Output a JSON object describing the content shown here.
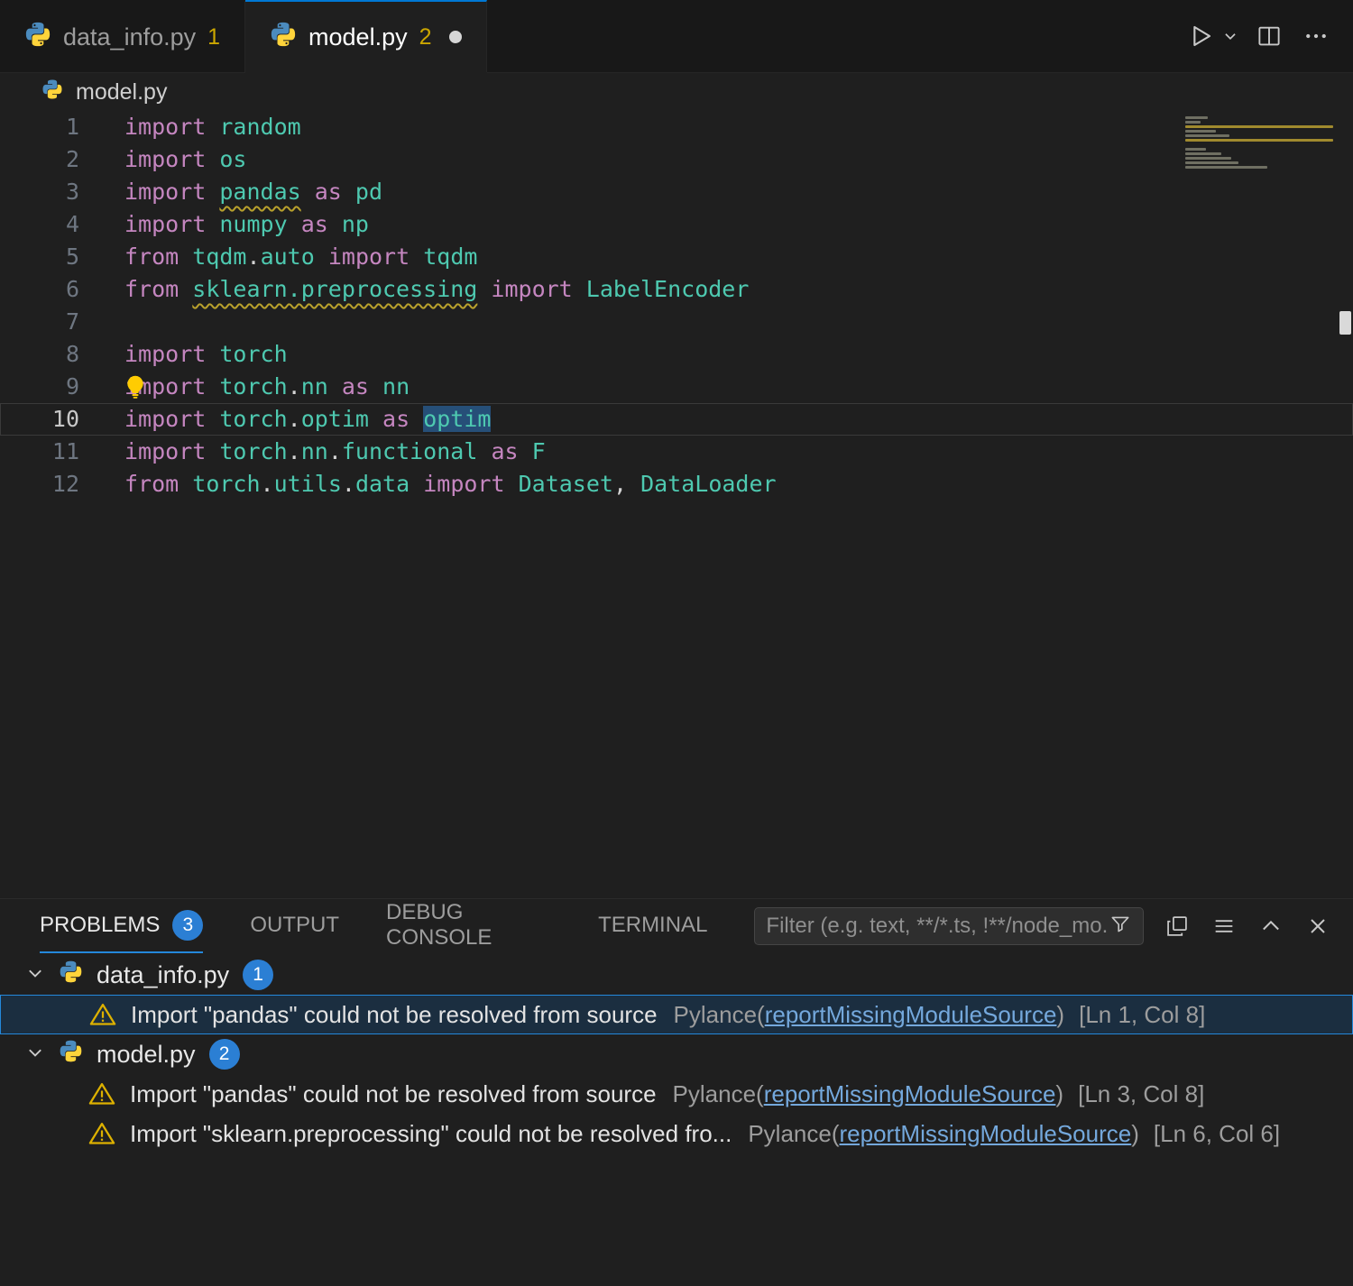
{
  "colors": {
    "accent": "#0078d4",
    "warning": "#cca700",
    "badge_blue": "#2b7fd4",
    "link": "#74a8dc",
    "selection": "#264f78",
    "keyword": "#c586c0",
    "module": "#4ec9b0"
  },
  "icons": {
    "python-icon": "python-logo",
    "run-icon": "play-triangle-outline",
    "run-chevron-icon": "chevron-down",
    "split-editor-icon": "rect-split-vertical",
    "more-actions-icon": "ellipsis",
    "filter-icon": "funnel",
    "collapse-all-icon": "overlapping-squares",
    "view-as-table-icon": "horizontal-lines",
    "maximize-panel-icon": "chevron-up",
    "close-panel-icon": "x",
    "warning-icon": "triangle-exclamation",
    "lightbulb-icon": "lightbulb",
    "chevron-down-icon": "chevron-down",
    "modified-dot": "filled-circle"
  },
  "editor_tabs": [
    {
      "label": "data_info.py",
      "badge": "1",
      "modified": false,
      "active": false
    },
    {
      "label": "model.py",
      "badge": "2",
      "modified": true,
      "active": true
    }
  ],
  "breadcrumb": {
    "file": "model.py"
  },
  "editor": {
    "lines": [
      {
        "num": "1",
        "tokens": [
          [
            "k",
            "import"
          ],
          [
            "p",
            " "
          ],
          [
            "m",
            "random"
          ]
        ]
      },
      {
        "num": "2",
        "tokens": [
          [
            "k",
            "import"
          ],
          [
            "p",
            " "
          ],
          [
            "m",
            "os"
          ]
        ]
      },
      {
        "num": "3",
        "warning": true,
        "tokens": [
          [
            "k",
            "import"
          ],
          [
            "p",
            " "
          ],
          [
            "mw",
            "pandas"
          ],
          [
            "p",
            " "
          ],
          [
            "k",
            "as"
          ],
          [
            "p",
            " "
          ],
          [
            "m",
            "pd"
          ]
        ]
      },
      {
        "num": "4",
        "tokens": [
          [
            "k",
            "import"
          ],
          [
            "p",
            " "
          ],
          [
            "m",
            "numpy"
          ],
          [
            "p",
            " "
          ],
          [
            "k",
            "as"
          ],
          [
            "p",
            " "
          ],
          [
            "m",
            "np"
          ]
        ]
      },
      {
        "num": "5",
        "tokens": [
          [
            "k",
            "from"
          ],
          [
            "p",
            " "
          ],
          [
            "m",
            "tqdm"
          ],
          [
            "p",
            "."
          ],
          [
            "m",
            "auto"
          ],
          [
            "p",
            " "
          ],
          [
            "k",
            "import"
          ],
          [
            "p",
            " "
          ],
          [
            "m",
            "tqdm"
          ]
        ]
      },
      {
        "num": "6",
        "warning": true,
        "tokens": [
          [
            "k",
            "from"
          ],
          [
            "p",
            " "
          ],
          [
            "mw",
            "sklearn.preprocessing"
          ],
          [
            "p",
            " "
          ],
          [
            "k",
            "import"
          ],
          [
            "p",
            " "
          ],
          [
            "m",
            "LabelEncoder"
          ]
        ]
      },
      {
        "num": "7",
        "tokens": []
      },
      {
        "num": "8",
        "tokens": [
          [
            "k",
            "import"
          ],
          [
            "p",
            " "
          ],
          [
            "m",
            "torch"
          ]
        ]
      },
      {
        "num": "9",
        "lightbulb": true,
        "tokens": [
          [
            "k",
            "import"
          ],
          [
            "p",
            " "
          ],
          [
            "m",
            "torch"
          ],
          [
            "p",
            "."
          ],
          [
            "m",
            "nn"
          ],
          [
            "p",
            " "
          ],
          [
            "k",
            "as"
          ],
          [
            "p",
            " "
          ],
          [
            "m",
            "nn"
          ]
        ]
      },
      {
        "num": "10",
        "current": true,
        "tokens": [
          [
            "k",
            "import"
          ],
          [
            "p",
            " "
          ],
          [
            "m",
            "torch"
          ],
          [
            "p",
            "."
          ],
          [
            "m",
            "optim"
          ],
          [
            "p",
            " "
          ],
          [
            "k",
            "as"
          ],
          [
            "p",
            " "
          ],
          [
            "msel",
            "optim"
          ]
        ]
      },
      {
        "num": "11",
        "tokens": [
          [
            "k",
            "import"
          ],
          [
            "p",
            " "
          ],
          [
            "m",
            "torch"
          ],
          [
            "p",
            "."
          ],
          [
            "m",
            "nn"
          ],
          [
            "p",
            "."
          ],
          [
            "m",
            "functional"
          ],
          [
            "p",
            " "
          ],
          [
            "k",
            "as"
          ],
          [
            "p",
            " "
          ],
          [
            "m",
            "F"
          ]
        ]
      },
      {
        "num": "12",
        "tokens": [
          [
            "k",
            "from"
          ],
          [
            "p",
            " "
          ],
          [
            "m",
            "torch"
          ],
          [
            "p",
            "."
          ],
          [
            "m",
            "utils"
          ],
          [
            "p",
            "."
          ],
          [
            "m",
            "data"
          ],
          [
            "p",
            " "
          ],
          [
            "k",
            "import"
          ],
          [
            "p",
            " "
          ],
          [
            "m",
            "Dataset"
          ],
          [
            "p",
            ", "
          ],
          [
            "m",
            "DataLoader"
          ]
        ]
      }
    ]
  },
  "panel": {
    "tabs": [
      {
        "label": "PROBLEMS",
        "badge": "3",
        "active": true
      },
      {
        "label": "OUTPUT",
        "active": false
      },
      {
        "label": "DEBUG CONSOLE",
        "active": false
      },
      {
        "label": "TERMINAL",
        "active": false
      }
    ],
    "filter_placeholder": "Filter (e.g. text, **/*.ts, !**/node_mo...",
    "groups": [
      {
        "file": "data_info.py",
        "count": "1",
        "items": [
          {
            "selected": true,
            "message": "Import \"pandas\" could not be resolved from source",
            "source": "Pylance",
            "code": "reportMissingModuleSource",
            "location": "[Ln 1, Col 8]"
          }
        ]
      },
      {
        "file": "model.py",
        "count": "2",
        "items": [
          {
            "selected": false,
            "message": "Import \"pandas\" could not be resolved from source",
            "source": "Pylance",
            "code": "reportMissingModuleSource",
            "location": "[Ln 3, Col 8]"
          },
          {
            "selected": false,
            "message": "Import \"sklearn.preprocessing\" could not be resolved fro...",
            "source": "Pylance",
            "code": "reportMissingModuleSource",
            "location": "[Ln 6, Col 6]"
          }
        ]
      }
    ]
  }
}
